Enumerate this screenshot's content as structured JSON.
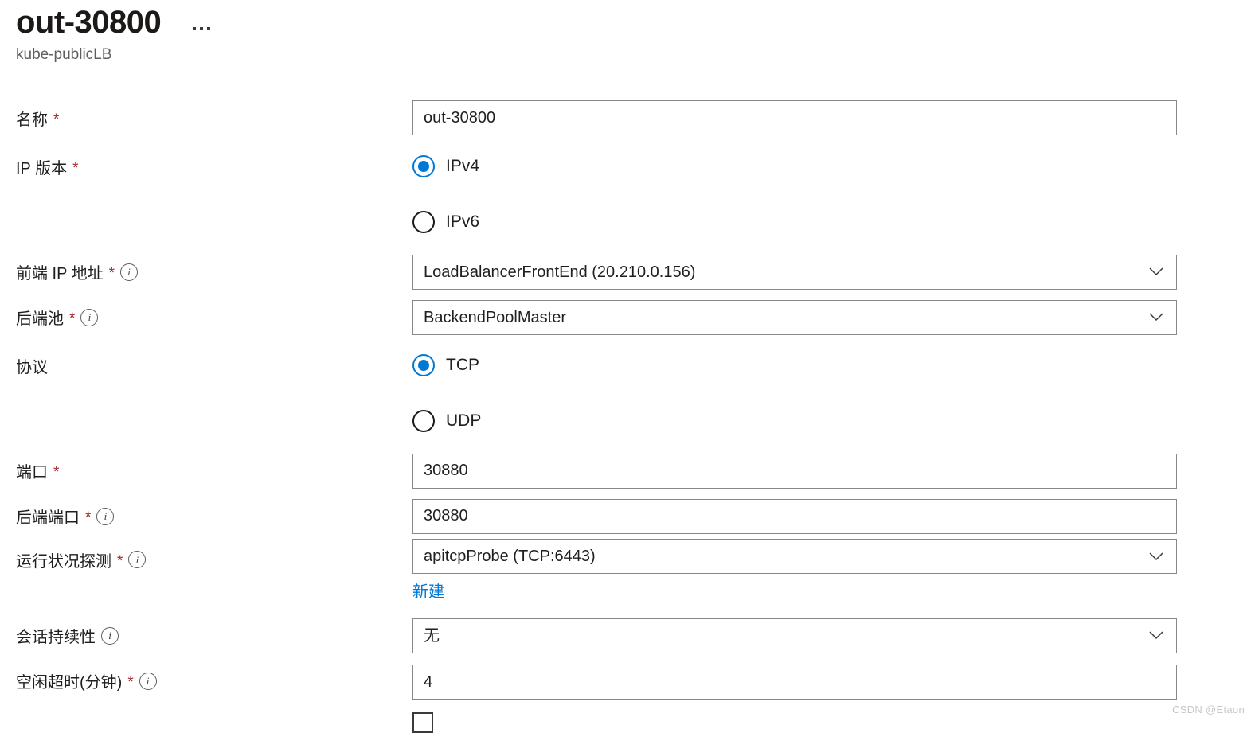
{
  "header": {
    "title": "out-30800",
    "subtitle": "kube-publicLB",
    "more_menu_label": "..."
  },
  "form": {
    "name": {
      "label": "名称",
      "required": "*",
      "value": "out-30800"
    },
    "ip_version": {
      "label": "IP 版本",
      "required": "*",
      "options": [
        {
          "label": "IPv4",
          "selected": true
        },
        {
          "label": "IPv6",
          "selected": false
        }
      ]
    },
    "frontend_ip": {
      "label": "前端 IP 地址",
      "required": "*",
      "info": "i",
      "value": "LoadBalancerFrontEnd (20.210.0.156)"
    },
    "backend_pool": {
      "label": "后端池",
      "required": "*",
      "info": "i",
      "value": "BackendPoolMaster"
    },
    "protocol": {
      "label": "协议",
      "options": [
        {
          "label": "TCP",
          "selected": true
        },
        {
          "label": "UDP",
          "selected": false
        }
      ]
    },
    "port": {
      "label": "端口",
      "required": "*",
      "value": "30880"
    },
    "backend_port": {
      "label": "后端端口",
      "required": "*",
      "info": "i",
      "value": "30880"
    },
    "health_probe": {
      "label": "运行状况探测",
      "required": "*",
      "info": "i",
      "value": "apitcpProbe (TCP:6443)",
      "create_new_link": "新建"
    },
    "session_persistence": {
      "label": "会话持续性",
      "info": "i",
      "value": "无"
    },
    "idle_timeout": {
      "label": "空闲超时(分钟)",
      "required": "*",
      "info": "i",
      "value": "4"
    }
  },
  "watermark": "CSDN @Etaon",
  "colors": {
    "accent": "#0078d4",
    "required_asterisk": "#a4262c",
    "border": "#8a8886",
    "text": "#201f1e",
    "subtitle": "#605e5c"
  }
}
